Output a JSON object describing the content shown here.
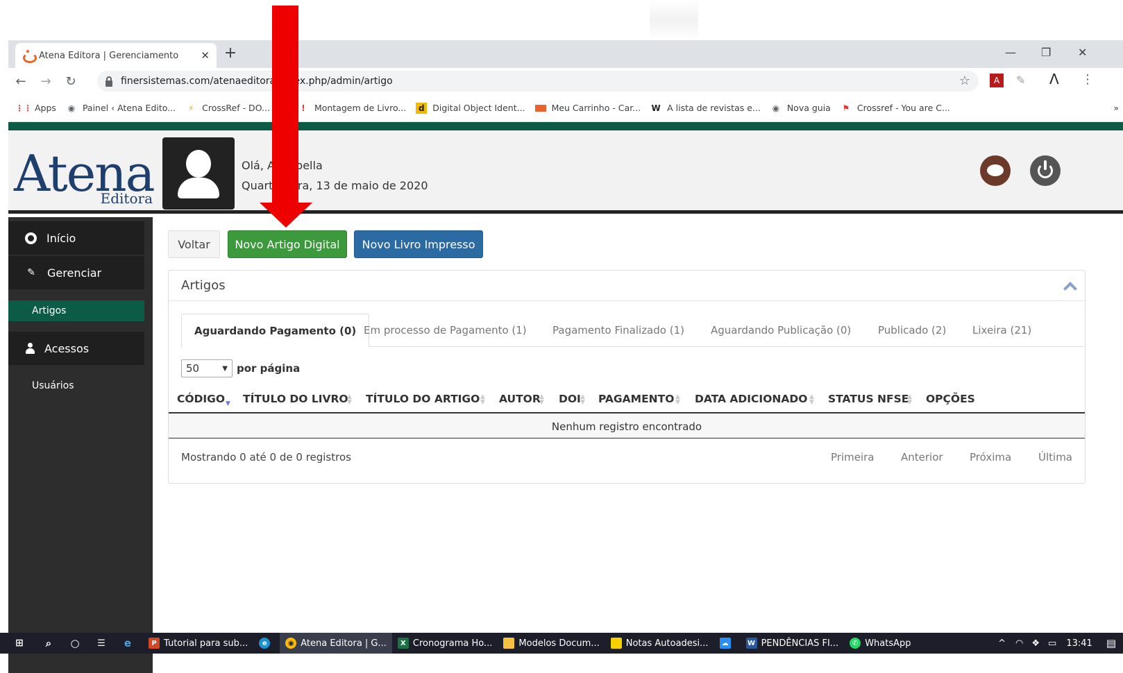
{
  "browser": {
    "tab_title": "Atena Editora | Gerenciamento",
    "url": "finersistemas.com/atenaeditora/index.php/admin/artigo",
    "bookmarks": [
      {
        "label": "Apps",
        "icon": "apps-grid-icon"
      },
      {
        "label": "Painel ‹ Atena Edito...",
        "icon": "globe-icon"
      },
      {
        "label": "CrossRef - DO...",
        "icon": "crossref-icon"
      },
      {
        "label": "Montagem de Livro...",
        "icon": "exclamation-icon"
      },
      {
        "label": "Digital Object Ident...",
        "icon": "doi-icon"
      },
      {
        "label": "Meu Carrinho - Car...",
        "icon": "card-icon"
      },
      {
        "label": "A lista de revistas e...",
        "icon": "w-icon"
      },
      {
        "label": "Nova guia",
        "icon": "globe-icon"
      },
      {
        "label": "Crossref - You are C...",
        "icon": "flag-icon"
      }
    ]
  },
  "header": {
    "logo_main": "Atena",
    "logo_sub": "Editora",
    "greeting": "Olá, Annabella",
    "date": "Quarta-feira, 13 de maio de 2020"
  },
  "sidebar": {
    "inicio": "Início",
    "gerenciar": "Gerenciar",
    "artigos": "Artigos",
    "acessos": "Acessos",
    "usuarios": "Usuários"
  },
  "actions": {
    "back": "Voltar",
    "new_article": "Novo Artigo Digital",
    "new_book": "Novo Livro Impresso"
  },
  "panel": {
    "title": "Artigos",
    "tabs": [
      "Aguardando Pagamento (0)",
      "Em processo de Pagamento (1)",
      "Pagamento Finalizado (1)",
      "Aguardando Publicação (0)",
      "Publicado (2)",
      "Lixeira (21)"
    ],
    "per_page_value": "50",
    "per_page_label": "por página",
    "columns": [
      "CÓDIGO",
      "TÍTULO DO LIVRO",
      "TÍTULO DO ARTIGO",
      "AUTOR",
      "DOI",
      "PAGAMENTO",
      "DATA ADICIONADO",
      "STATUS NFSE",
      "OPÇÕES"
    ],
    "empty_message": "Nenhum registro encontrado",
    "info": "Mostrando 0 até 0 de 0 registros",
    "pagination": [
      "Primeira",
      "Anterior",
      "Próxima",
      "Última"
    ]
  },
  "taskbar": {
    "items": [
      {
        "label": "Tutorial para sub...",
        "icon": "powerpoint-icon"
      },
      {
        "label": "",
        "icon": "edge-icon"
      },
      {
        "label": "Atena Editora | G...",
        "icon": "chrome-icon"
      },
      {
        "label": "Cronograma Ho...",
        "icon": "excel-icon"
      },
      {
        "label": "Modelos Docum...",
        "icon": "folder-icon"
      },
      {
        "label": "Notas Autoadesi...",
        "icon": "sticky-notes-icon"
      },
      {
        "label": "",
        "icon": "cloud-icon"
      },
      {
        "label": "PENDÊNCIAS FI...",
        "icon": "word-icon"
      },
      {
        "label": "WhatsApp",
        "icon": "whatsapp-icon"
      }
    ],
    "clock": "13:41"
  },
  "colors": {
    "brand_green": "#0c5b46",
    "button_green": "#3c9a3c",
    "button_blue": "#2c6aa3",
    "annotation_red": "#ee0000"
  }
}
